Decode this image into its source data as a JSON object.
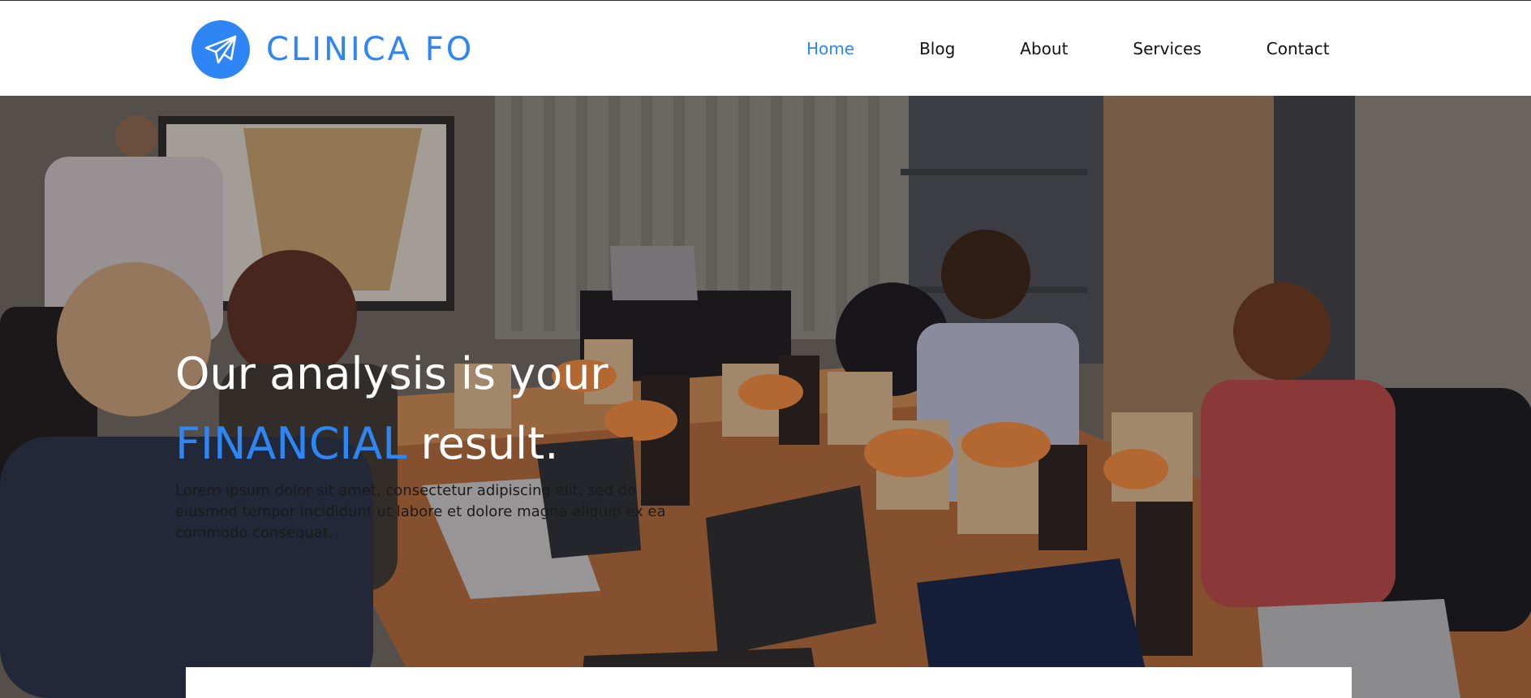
{
  "brand": {
    "name": "CLINICA FO",
    "logo_icon": "paper-plane-icon",
    "accent_color": "#2e86f5"
  },
  "nav": {
    "items": [
      {
        "label": "Home",
        "active": true
      },
      {
        "label": "Blog",
        "active": false
      },
      {
        "label": "About",
        "active": false
      },
      {
        "label": "Services",
        "active": false
      },
      {
        "label": "Contact",
        "active": false
      }
    ]
  },
  "hero": {
    "title_line1": "Our analysis is your",
    "title_accent": "FINANCIAL",
    "title_rest": " result.",
    "body": "Lorem ipsum dolor sit amet, consectetur adipiscing elit, sed do eiusmod tempor incididunt ut labore et dolore magna aliquip ex ea commodo consequat.",
    "background": "office-meeting-photo"
  }
}
